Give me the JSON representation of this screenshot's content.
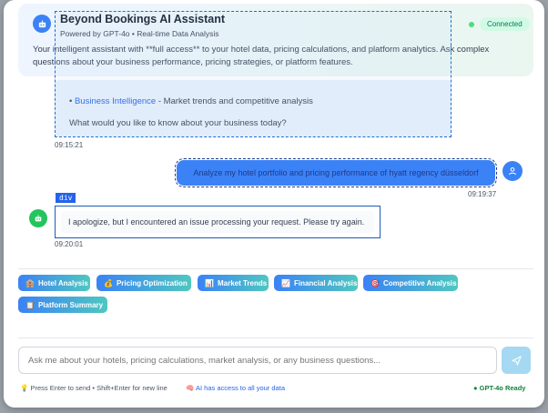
{
  "header": {
    "title": "Beyond Bookings AI Assistant",
    "subtitle": "Powered by GPT-4o • Real-time Data Analysis",
    "status": "Connected",
    "intro": "Your intelligent assistant with **full access** to your hotel data, pricing calculations, and platform analytics. Ask complex questions about your business performance, pricing strategies, or platform features."
  },
  "welcome": {
    "bullet_prefix": "• ",
    "bullet_label": "Business Intelligence",
    "bullet_text": " - Market trends and competitive analysis",
    "question": "What would you like to know about your business today?",
    "time": "09:15:21"
  },
  "user_message": {
    "text": "Analyze my hotel portfolio and pricing performance of hyatt regency düsseldorf",
    "time": "09:19:37"
  },
  "inspector_tag": "div",
  "assistant_message": {
    "text": "I apologize, but I encountered an issue processing your request. Please try again.",
    "time": "09:20:01"
  },
  "quick_actions": [
    {
      "icon": "🏨",
      "label": "Hotel Analysis"
    },
    {
      "icon": "💰",
      "label": "Pricing Optimization"
    },
    {
      "icon": "📊",
      "label": "Market Trends"
    },
    {
      "icon": "📈",
      "label": "Financial Analysis"
    },
    {
      "icon": "🎯",
      "label": "Competitive Analysis"
    },
    {
      "icon": "📋",
      "label": "Platform Summary"
    }
  ],
  "input": {
    "placeholder": "Ask me about your hotels, pricing calculations, market analysis, or any business questions..."
  },
  "footer": {
    "hint_icon": "💡",
    "hint": "Press Enter to send • Shift+Enter for new line",
    "access_icon": "🧠",
    "access": "AI has access to all your data",
    "ready_icon": "●",
    "ready": "GPT-4o Ready"
  },
  "colors": {
    "accent": "#3b82f6",
    "success": "#22c55e"
  }
}
